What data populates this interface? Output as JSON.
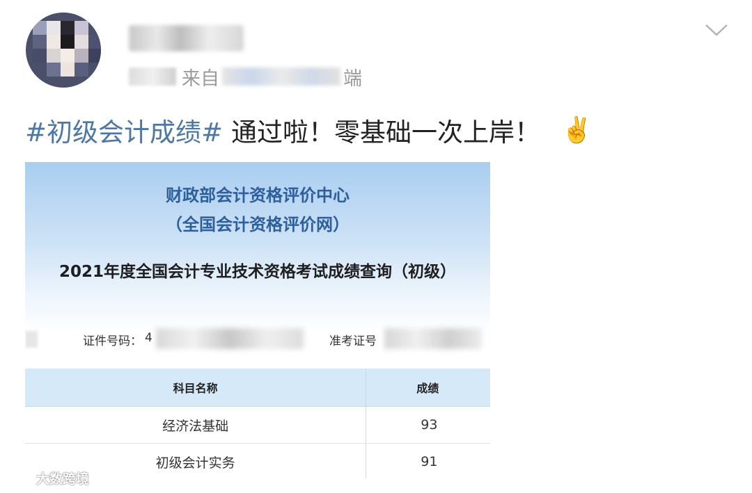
{
  "header": {
    "source_prefix": "来自",
    "source_suffix": "端"
  },
  "post": {
    "hashtag": "#初级会计成绩#",
    "text": "通过啦！零基础一次上岸！",
    "emoji": "✌️"
  },
  "result_card": {
    "org_line1": "财政部会计资格评价中心",
    "org_line2": "（全国会计资格评价网）",
    "exam_title": "2021年度全国会计专业技术资格考试成绩查询（初级）",
    "id_label": "证件号码：",
    "id_visible_prefix": "4",
    "ticket_label": "准考证号",
    "table": {
      "headers": [
        "科目名称",
        "成绩"
      ],
      "rows": [
        {
          "subject": "经济法基础",
          "score": "93"
        },
        {
          "subject": "初级会计实务",
          "score": "91"
        }
      ]
    }
  },
  "watermark": {
    "text": "大数跨境"
  },
  "colors": {
    "hashtag": "#4b78a8",
    "org_title": "#2d5f9d",
    "table_header_bg": "#d6e9f8"
  }
}
